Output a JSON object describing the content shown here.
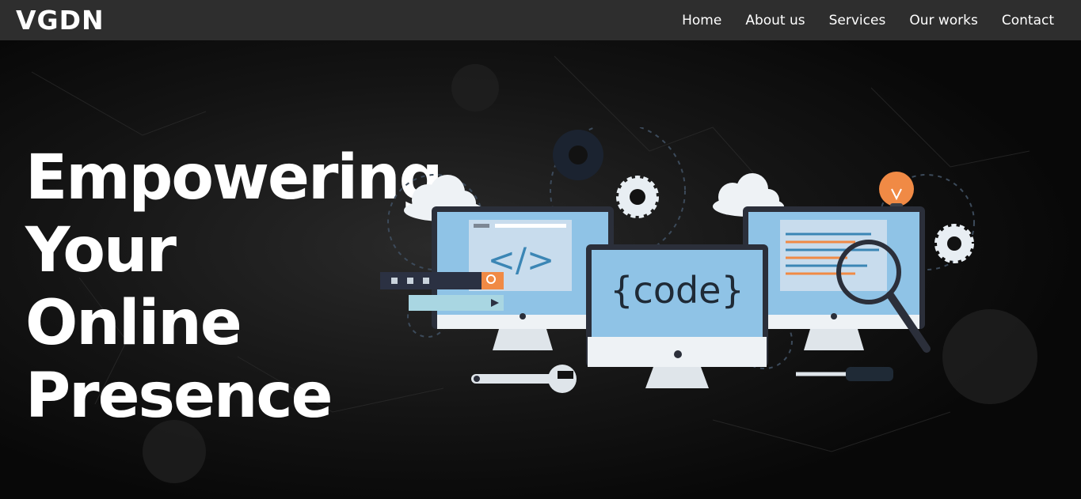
{
  "brand": {
    "logo_text": "VGDN"
  },
  "nav": {
    "items": [
      {
        "label": "Home"
      },
      {
        "label": "About us"
      },
      {
        "label": "Services"
      },
      {
        "label": "Our works"
      },
      {
        "label": "Contact"
      }
    ]
  },
  "hero": {
    "headline_lines": [
      "Empowering",
      "Your",
      "Online",
      "Presence"
    ],
    "illustration": {
      "left_screen_text": "</>",
      "center_screen_text": "{code}"
    }
  },
  "colors": {
    "navbar_bg": "#2e2e2e",
    "hero_bg": "#121212",
    "screen_blue": "#8fc3e6",
    "accent_orange": "#f08a45",
    "monitor_frame": "#2b2f3a"
  }
}
